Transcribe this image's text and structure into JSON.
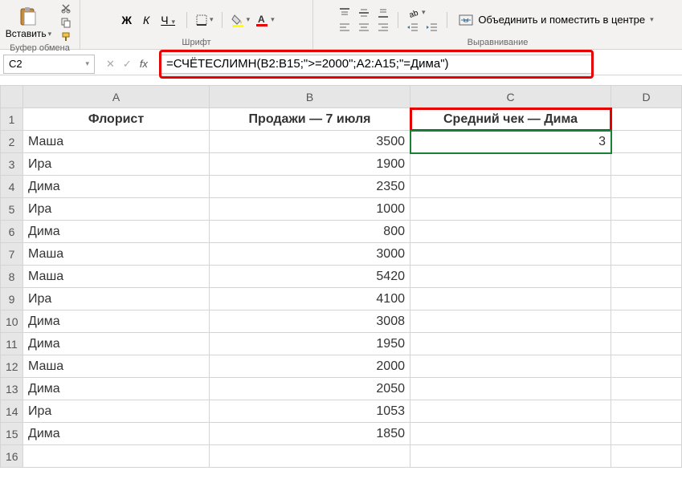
{
  "ribbon": {
    "clipboard": {
      "paste": "Вставить",
      "group_label": "Буфер обмена"
    },
    "font": {
      "bold": "Ж",
      "italic": "К",
      "underline": "Ч",
      "group_label": "Шрифт"
    },
    "alignment": {
      "merge": "Объединить и поместить в центре",
      "group_label": "Выравнивание"
    }
  },
  "formula_bar": {
    "cell_ref": "C2",
    "fx": "fx",
    "formula": "=СЧЁТЕСЛИМН(B2:B15;\">=2000\";A2:A15;\"=Дима\")"
  },
  "columns": [
    "A",
    "B",
    "C",
    "D"
  ],
  "headers": {
    "A": "Флорист",
    "B": "Продажи — 7 июля",
    "C": "Средний чек — Дима"
  },
  "rows": [
    {
      "n": 2,
      "florist": "Маша",
      "sales": 3500,
      "avg": 3
    },
    {
      "n": 3,
      "florist": "Ира",
      "sales": 1900
    },
    {
      "n": 4,
      "florist": "Дима",
      "sales": 2350
    },
    {
      "n": 5,
      "florist": "Ира",
      "sales": 1000
    },
    {
      "n": 6,
      "florist": "Дима",
      "sales": 800
    },
    {
      "n": 7,
      "florist": "Маша",
      "sales": 3000
    },
    {
      "n": 8,
      "florist": "Маша",
      "sales": 5420
    },
    {
      "n": 9,
      "florist": "Ира",
      "sales": 4100
    },
    {
      "n": 10,
      "florist": "Дима",
      "sales": 3008
    },
    {
      "n": 11,
      "florist": "Дима",
      "sales": 1950
    },
    {
      "n": 12,
      "florist": "Маша",
      "sales": 2000
    },
    {
      "n": 13,
      "florist": "Дима",
      "sales": 2050
    },
    {
      "n": 14,
      "florist": "Ира",
      "sales": 1053
    },
    {
      "n": 15,
      "florist": "Дима",
      "sales": 1850
    }
  ]
}
